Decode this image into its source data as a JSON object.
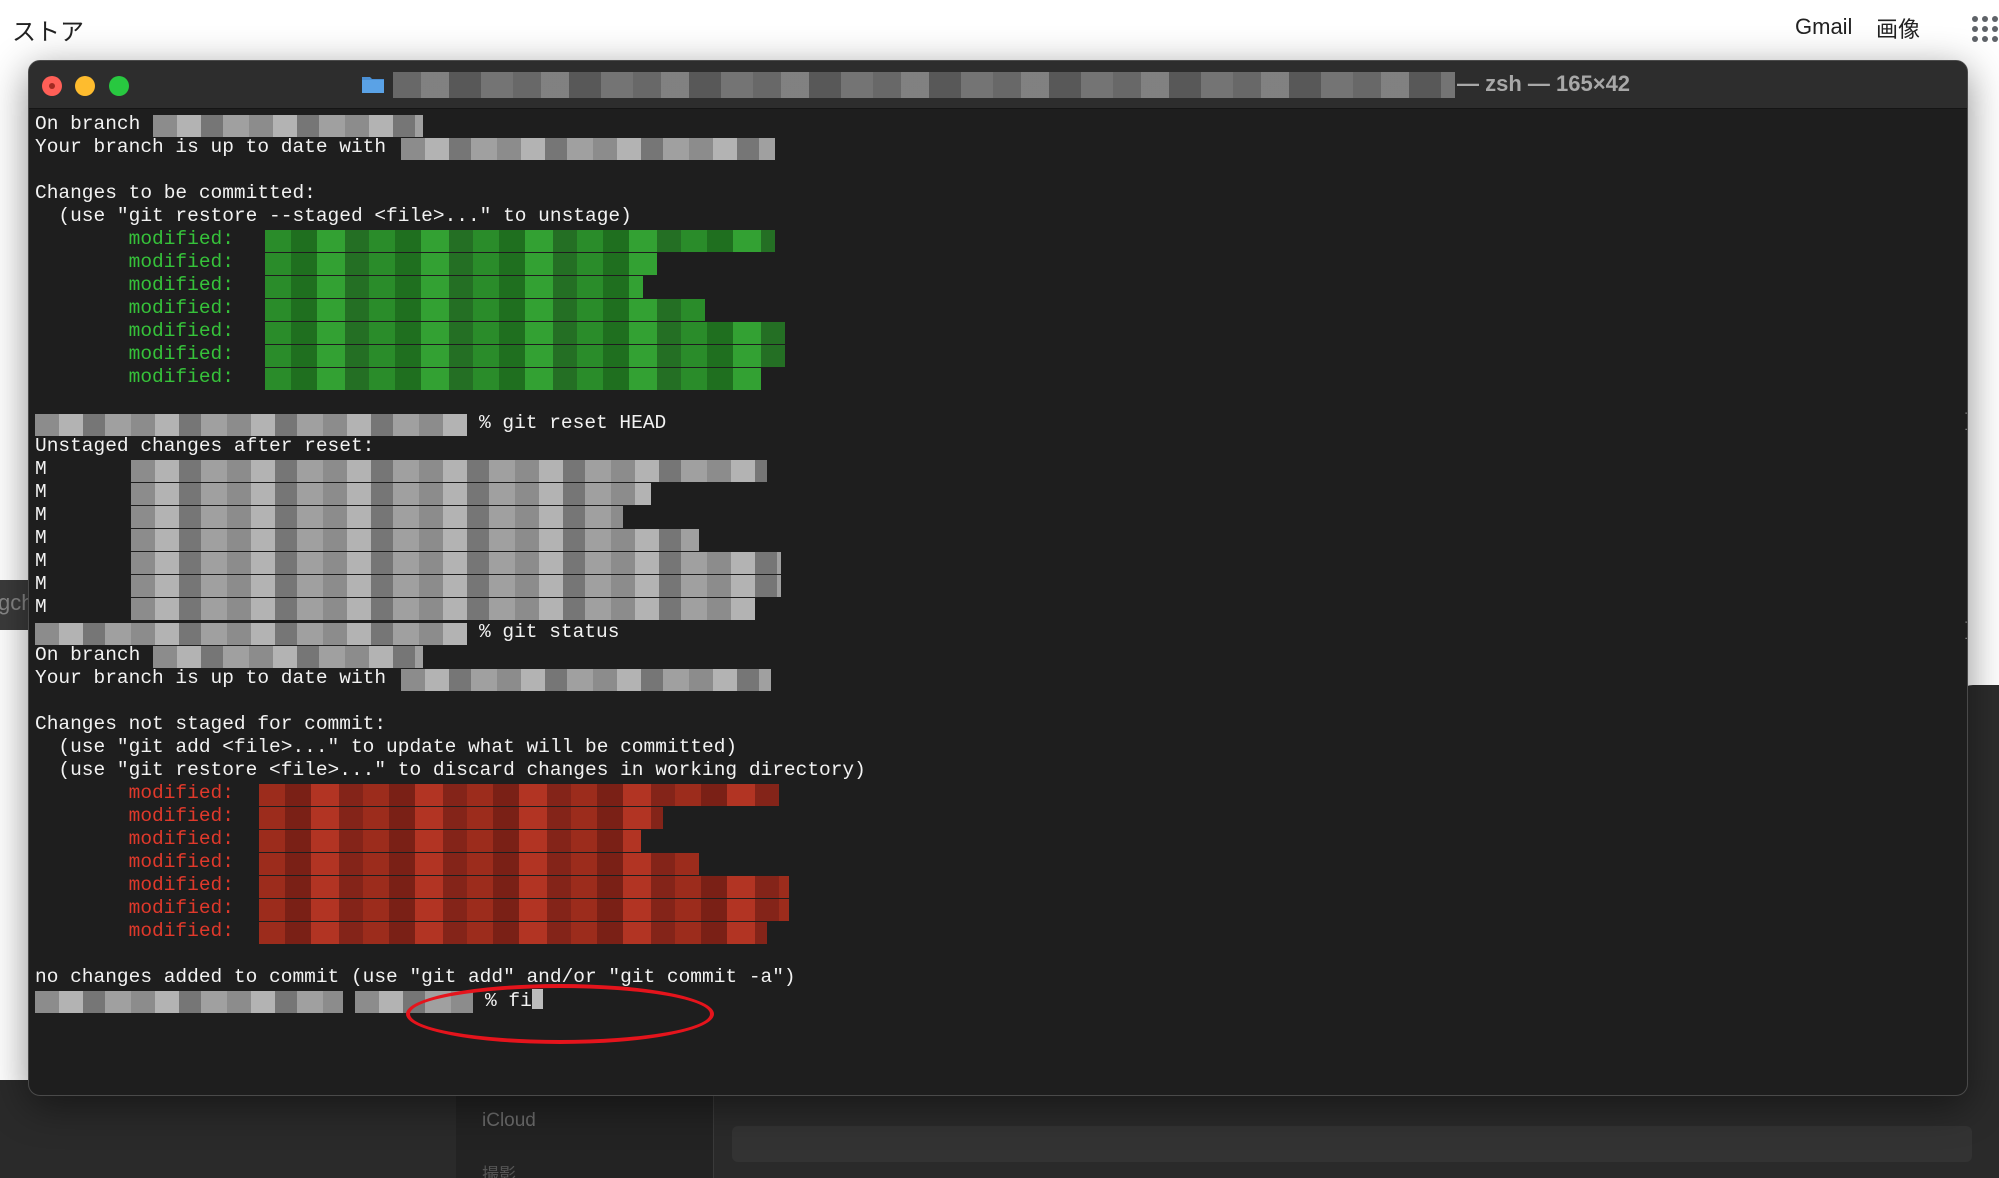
{
  "browser": {
    "store": "ストア",
    "gmail": "Gmail",
    "images": "画像",
    "apps_icon": "apps-grid-icon"
  },
  "background_app": {
    "icloud": "iCloud",
    "sub_item": "撮影",
    "left_text": "gch"
  },
  "terminal": {
    "title_suffix": "— zsh — 165×42",
    "lines": {
      "l1": "On branch",
      "l2": "Your branch is up to date with",
      "l3": "Changes to be committed:",
      "l4": "  (use \"git restore --staged <file>...\" to unstage)",
      "mod": "        modified:",
      "cmd1": "% git reset HEAD",
      "l5": "Unstaged changes after reset:",
      "m": "M",
      "cmd2": "% git status",
      "l6": "On branch",
      "l7": "Your branch is up to date with",
      "l8": "Changes not staged for commit:",
      "l9": "  (use \"git add <file>...\" to update what will be committed)",
      "l10": "  (use \"git restore <file>...\" to discard changes in working directory)",
      "l11": "no changes added to commit (use \"git add\" and/or \"git commit -a\")",
      "prompt": "% fi"
    }
  },
  "colors": {
    "green": "#36c23a",
    "red": "#e0392b",
    "annotation": "#e5141c"
  }
}
